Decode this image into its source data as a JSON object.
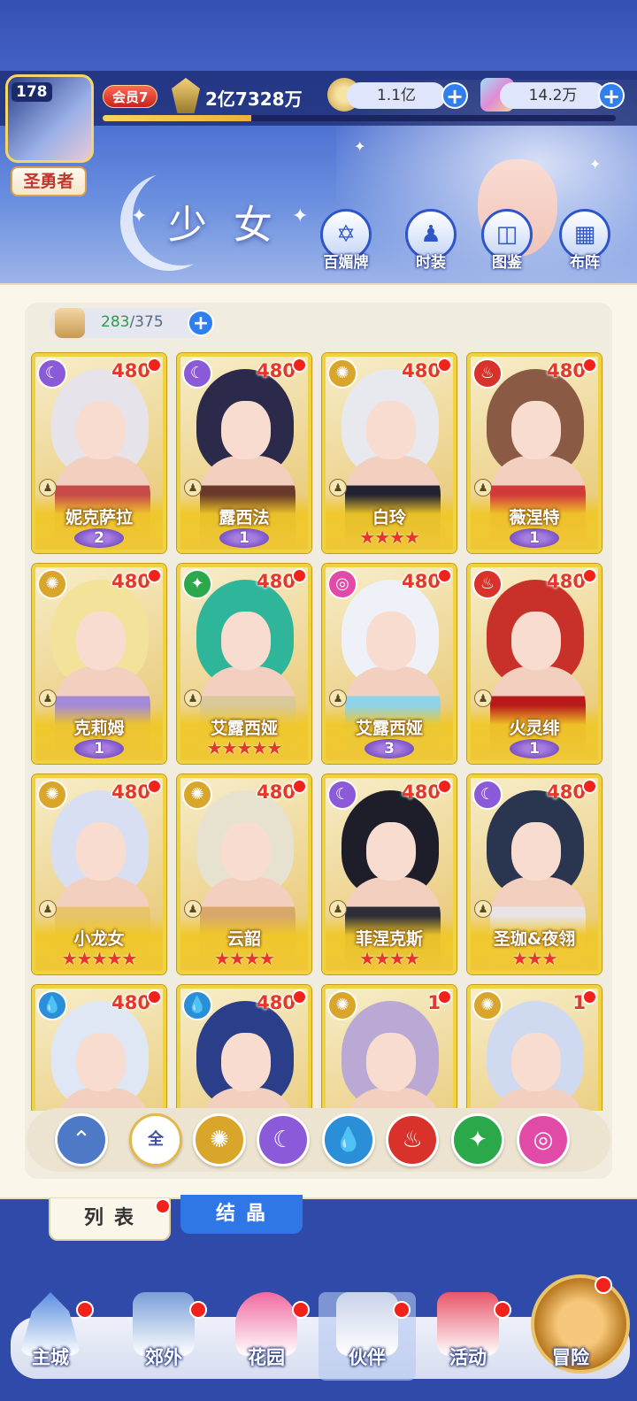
{
  "header": {
    "player_level": "178",
    "title_badge": "圣勇者",
    "vip_label": "会员7",
    "power": "2亿7328万",
    "exp_fraction": 0.29,
    "gold": "1.1亿",
    "diamonds": "14.2万",
    "page_title": "少女"
  },
  "menu": [
    {
      "label": "百媚牌",
      "icon": "card-badge-icon"
    },
    {
      "label": "时装",
      "icon": "outfit-icon"
    },
    {
      "label": "图鉴",
      "icon": "book-icon"
    },
    {
      "label": "布阵",
      "icon": "formation-grid-icon"
    }
  ],
  "capacity": {
    "current": "283",
    "max": "/375"
  },
  "cards": [
    {
      "name": "妮克萨拉",
      "score": "480",
      "element": "moon",
      "rank_type": "wing",
      "rank": "2",
      "colors": [
        "#e7e3ea",
        "#c74a4a"
      ]
    },
    {
      "name": "露西法",
      "score": "480",
      "element": "moon",
      "rank_type": "wing",
      "rank": "1",
      "colors": [
        "#2b2a4a",
        "#6a3a2a"
      ]
    },
    {
      "name": "白玲",
      "score": "480",
      "element": "sun",
      "rank_type": "stars",
      "rank": "★★★★",
      "colors": [
        "#e8e8ef",
        "#222233"
      ]
    },
    {
      "name": "薇涅特",
      "score": "480",
      "element": "fire",
      "rank_type": "wing",
      "rank": "1",
      "colors": [
        "#8a5a44",
        "#d23a3a"
      ]
    },
    {
      "name": "克莉姆",
      "score": "480",
      "element": "sun",
      "rank_type": "wing",
      "rank": "1",
      "colors": [
        "#f3e29a",
        "#a48ad6"
      ]
    },
    {
      "name": "艾露西娅",
      "score": "480",
      "element": "wind",
      "rank_type": "stars",
      "rank": "★★★★★",
      "colors": [
        "#2fb59a",
        "#d8c89a"
      ]
    },
    {
      "name": "艾露西娅",
      "score": "480",
      "element": "pink",
      "rank_type": "wing",
      "rank": "3",
      "colors": [
        "#eef1f7",
        "#8fd3ea"
      ]
    },
    {
      "name": "火灵绯",
      "score": "480",
      "element": "fire",
      "rank_type": "wing",
      "rank": "1",
      "colors": [
        "#c8302a",
        "#b81a1a"
      ]
    },
    {
      "name": "小龙女",
      "score": "480",
      "element": "sun",
      "rank_type": "stars",
      "rank": "★★★★★",
      "colors": [
        "#d9dff2",
        "#e7c36a"
      ]
    },
    {
      "name": "云韶",
      "score": "480",
      "element": "sun",
      "rank_type": "stars",
      "rank": "★★★★",
      "colors": [
        "#e7e2cf",
        "#d8a86a"
      ]
    },
    {
      "name": "菲涅克斯",
      "score": "480",
      "element": "moon",
      "rank_type": "stars",
      "rank": "★★★★",
      "colors": [
        "#1e1e2a",
        "#2e2e3a"
      ]
    },
    {
      "name": "圣珈&夜翎",
      "score": "480",
      "element": "moon",
      "rank_type": "stars",
      "rank": "★★★",
      "colors": [
        "#2a3550",
        "#e8e3e6"
      ]
    },
    {
      "name": "",
      "score": "480",
      "element": "water",
      "rank_type": "none",
      "rank": "",
      "colors": [
        "#dfe7f5",
        "#ffffff"
      ]
    },
    {
      "name": "",
      "score": "480",
      "element": "water",
      "rank_type": "none",
      "rank": "",
      "colors": [
        "#2a3e8a",
        "#3a2a6a"
      ]
    },
    {
      "name": "",
      "score": "1",
      "element": "sun",
      "rank_type": "none",
      "rank": "",
      "colors": [
        "#b9a9d4",
        "#c8a030"
      ]
    },
    {
      "name": "",
      "score": "1",
      "element": "sun",
      "rank_type": "none",
      "rank": "",
      "colors": [
        "#cfdaf0",
        "#e8e2dc"
      ]
    }
  ],
  "filters": [
    {
      "id": "all-elements",
      "glyph": "⌃",
      "color": "#4d79c7"
    },
    {
      "id": "all",
      "glyph": "全",
      "color": "#ffffff"
    },
    {
      "id": "sun",
      "glyph": "✺",
      "color": "#d9a52a"
    },
    {
      "id": "moon",
      "glyph": "☾",
      "color": "#8a5ad8"
    },
    {
      "id": "water",
      "glyph": "💧",
      "color": "#2a8fd8"
    },
    {
      "id": "fire",
      "glyph": "♨",
      "color": "#d8322a"
    },
    {
      "id": "wind",
      "glyph": "✦",
      "color": "#2aa84a"
    },
    {
      "id": "pink",
      "glyph": "◎",
      "color": "#e24aa8"
    }
  ],
  "element_colors": {
    "moon": "#8a5ad8",
    "sun": "#d9a52a",
    "fire": "#d8322a",
    "wind": "#2aa84a",
    "pink": "#e24aa8",
    "water": "#2a8fd8"
  },
  "element_glyphs": {
    "moon": "☾",
    "sun": "✺",
    "fire": "♨",
    "wind": "✦",
    "pink": "◎",
    "water": "💧"
  },
  "tabs": {
    "list": "列表",
    "crystal": "结晶"
  },
  "nav": [
    {
      "label": "主城",
      "icon": "castle-icon",
      "color": "#5b8fe0"
    },
    {
      "label": "郊外",
      "icon": "outskirts-icon",
      "color": "#7a9fd8"
    },
    {
      "label": "花园",
      "icon": "heart-garden-icon",
      "color": "#f06aa0"
    },
    {
      "label": "伙伴",
      "icon": "partner-portrait-icon",
      "color": "#c9d2ea"
    },
    {
      "label": "活动",
      "icon": "gift-box-icon",
      "color": "#e8566a"
    },
    {
      "label": "冒险",
      "icon": "compass-icon",
      "color": "#d08a3a"
    }
  ]
}
